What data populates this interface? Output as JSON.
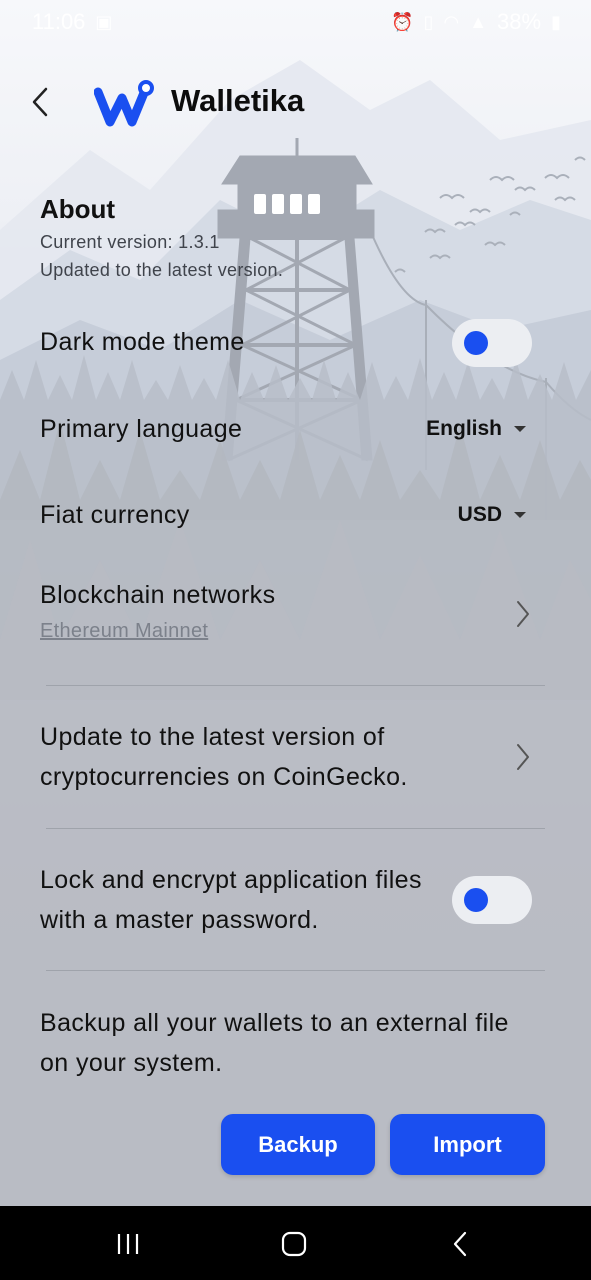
{
  "status_bar": {
    "time": "11:06",
    "battery": "38%",
    "icons": [
      "gallery-icon",
      "alarm-icon",
      "vibrate-icon",
      "wifi-icon",
      "signal-icon",
      "battery-icon"
    ]
  },
  "header": {
    "app_name": "Walletika",
    "back_icon": "back-arrow-icon",
    "logo_icon": "walletika-logo-icon"
  },
  "about": {
    "title": "About",
    "version": "Current version: 1.3.1",
    "update_status": "Updated to the latest version."
  },
  "settings": {
    "dark_mode": {
      "label": "Dark mode theme",
      "enabled": false
    },
    "language": {
      "label": "Primary language",
      "value": "English"
    },
    "fiat": {
      "label": "Fiat currency",
      "value": "USD"
    },
    "blockchain": {
      "label": "Blockchain networks",
      "value": "Ethereum Mainnet"
    },
    "update_coingecko": {
      "label": "Update to the latest version of cryptocurrencies on CoinGecko."
    },
    "lock": {
      "label": "Lock and encrypt application files with a master password.",
      "enabled": false
    },
    "backup": {
      "label": "Backup all your wallets to an external file on your system."
    }
  },
  "buttons": {
    "backup": "Backup",
    "import": "Import"
  },
  "colors": {
    "accent": "#1a4ff0",
    "toggle_track": "#eceef2",
    "muted_text": "#7c818b"
  },
  "nav_bar": {
    "icons": [
      "recent-apps-icon",
      "home-icon",
      "back-icon"
    ]
  }
}
